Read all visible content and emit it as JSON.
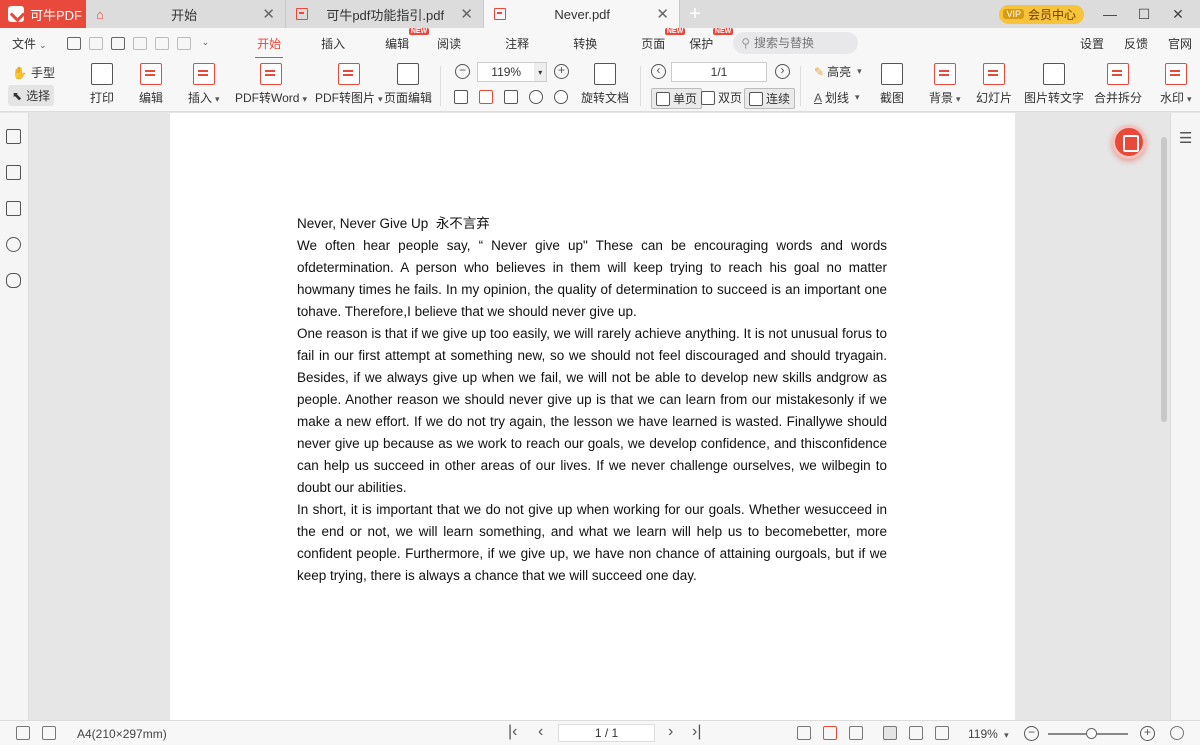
{
  "app": {
    "brand": "可牛PDF"
  },
  "tabs": [
    {
      "label": "开始",
      "icon": "home-icon"
    },
    {
      "label": "可牛pdf功能指引.pdf",
      "icon": "pdf-file-icon"
    },
    {
      "label": "Never.pdf",
      "icon": "pdf-file-icon",
      "active": true
    }
  ],
  "titlebar": {
    "vip_label": "会员中心",
    "vip_badge": "VIP"
  },
  "menu": {
    "file": "文件",
    "items": [
      "开始",
      "插入",
      "编辑",
      "阅读",
      "注释",
      "转换",
      "页面",
      "保护"
    ],
    "active": "开始",
    "new_badge": "NEW",
    "search_placeholder": "搜索与替换",
    "right": [
      "设置",
      "反馈",
      "官网"
    ]
  },
  "toolbar": {
    "hand": "手型",
    "select": "选择",
    "print": "打印",
    "edit": "编辑",
    "insert": "插入",
    "pdf_to_word": "PDF转Word",
    "pdf_to_image": "PDF转图片",
    "page_edit": "页面编辑",
    "zoom": "119%",
    "rotate_doc": "旋转文档",
    "page_input": "1/1",
    "single": "单页",
    "double": "双页",
    "continuous": "连续",
    "highlight": "高亮",
    "strikethrough": "划线",
    "screenshot": "截图",
    "background": "背景",
    "slideshow": "幻灯片",
    "image_to_text": "图片转文字",
    "merge_split": "合并拆分",
    "watermark": "水印"
  },
  "document": {
    "title": "Never, Never Give Up",
    "title_cn": "永不言弃",
    "paragraphs": [
      "We often hear people say, “ Never give up\" These can be encouraging words and words ofdetermination. A person who believes in them will keep trying to reach his goal no matter howmany times he fails. In my opinion, the quality of determination to succeed is an important one tohave. Therefore,I believe that we should never give up.",
      "One reason is that if we give up too easily, we will rarely achieve anything. It is not unusual forus to fail in our first attempt at something new, so we should not feel discouraged and should tryagain. Besides, if we always give up when we fail, we will not be able to develop new skills andgrow as people. Another reason we should never give up is that we can learn from our mistakesonly if we make a new effort. If we do not try again, the lesson we have learned is wasted. Finallywe should never give up because as we work to reach our goals, we develop confidence, and thisconfidence can help us succeed in other areas of our lives. If we never challenge ourselves, we wilbegin to doubt our abilities.",
      "In short, it is important that we do not give up when working for our goals. Whether wesucceed in the end or not, we will learn something, and what we learn will help us to becomebetter, more confident people. Furthermore, if we give up, we have non chance of attaining ourgoals, but if we keep trying, there is always a chance that we will succeed one day."
    ]
  },
  "statusbar": {
    "page_size": "A4(210×297mm)",
    "page_input": "1 / 1",
    "zoom": "119%"
  }
}
